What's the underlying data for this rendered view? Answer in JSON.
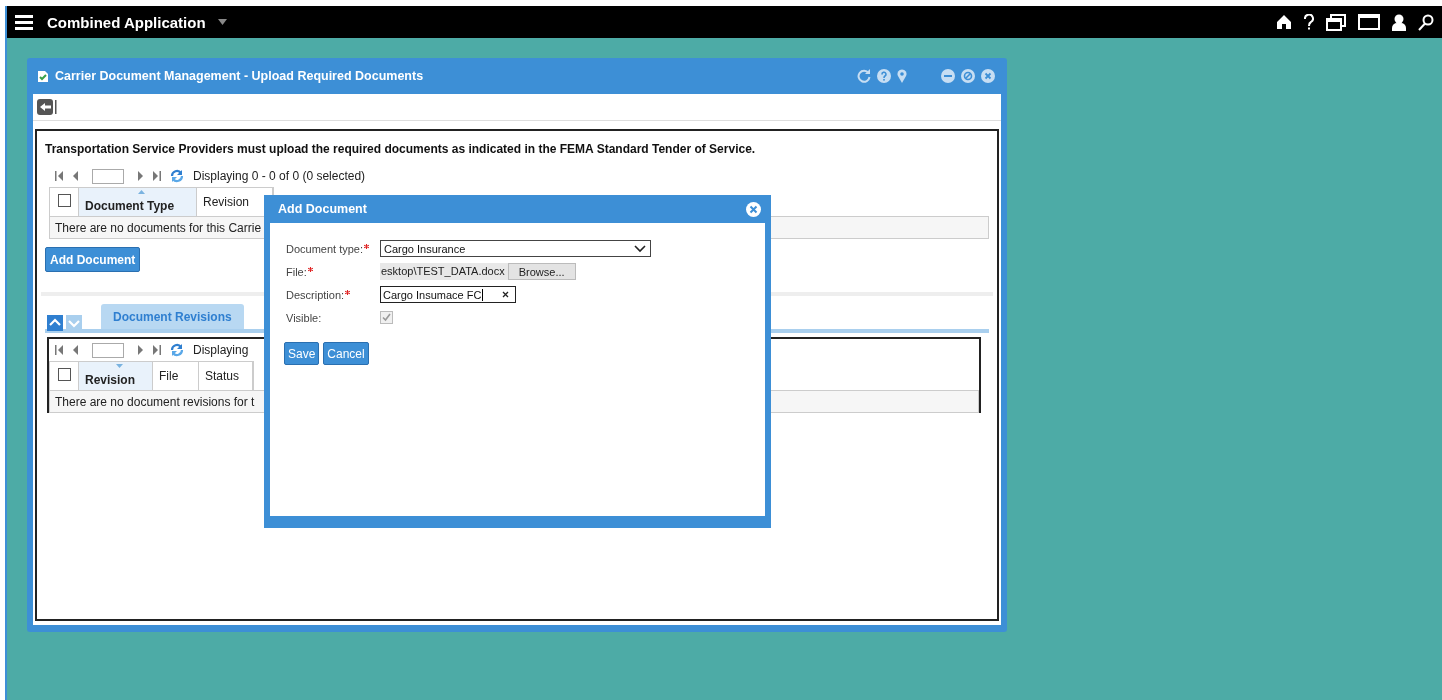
{
  "app_bar": {
    "title": "Combined Application"
  },
  "window": {
    "title": "Carrier Document Management - Upload Required Documents"
  },
  "notice": "Transportation Service Providers must upload the required documents as indicated in the FEMA Standard Tender of Service.",
  "documents_grid": {
    "pager": "Displaying 0 - 0 of 0 (0 selected)",
    "all_selected": false,
    "sort_descending": false,
    "columns": [
      {
        "label": "Document Type",
        "sorted": true
      },
      {
        "label": "Revision",
        "sorted": false
      }
    ],
    "empty_message": "There are no documents for this Carrie"
  },
  "add_button": "Add Document",
  "tabs": [
    {
      "label": "Document Revisions",
      "selected": true
    }
  ],
  "revisions_grid": {
    "pager": "Displaying",
    "all_selected": false,
    "sort_descending": true,
    "columns": [
      {
        "label": "Revision",
        "sorted": true
      },
      {
        "label": "File",
        "sorted": false
      },
      {
        "label": "Status",
        "sorted": false
      }
    ],
    "empty_message": "There are no document revisions for t"
  },
  "dialog": {
    "title": "Add Document",
    "fields": [
      {
        "kind": "select",
        "label": "Document type:",
        "required": true,
        "value": "Cargo Insurance"
      },
      {
        "kind": "file",
        "label": "File:",
        "required": true,
        "value": "esktop\\TEST_DATA.docx",
        "button": "Browse..."
      },
      {
        "kind": "text",
        "label": "Description:",
        "required": true,
        "value": "Cargo Insumace FC"
      },
      {
        "kind": "checkbox",
        "label": "Visible:",
        "required": false,
        "checked": true,
        "disabled": true
      }
    ],
    "buttons": [
      "Save",
      "Cancel"
    ]
  }
}
